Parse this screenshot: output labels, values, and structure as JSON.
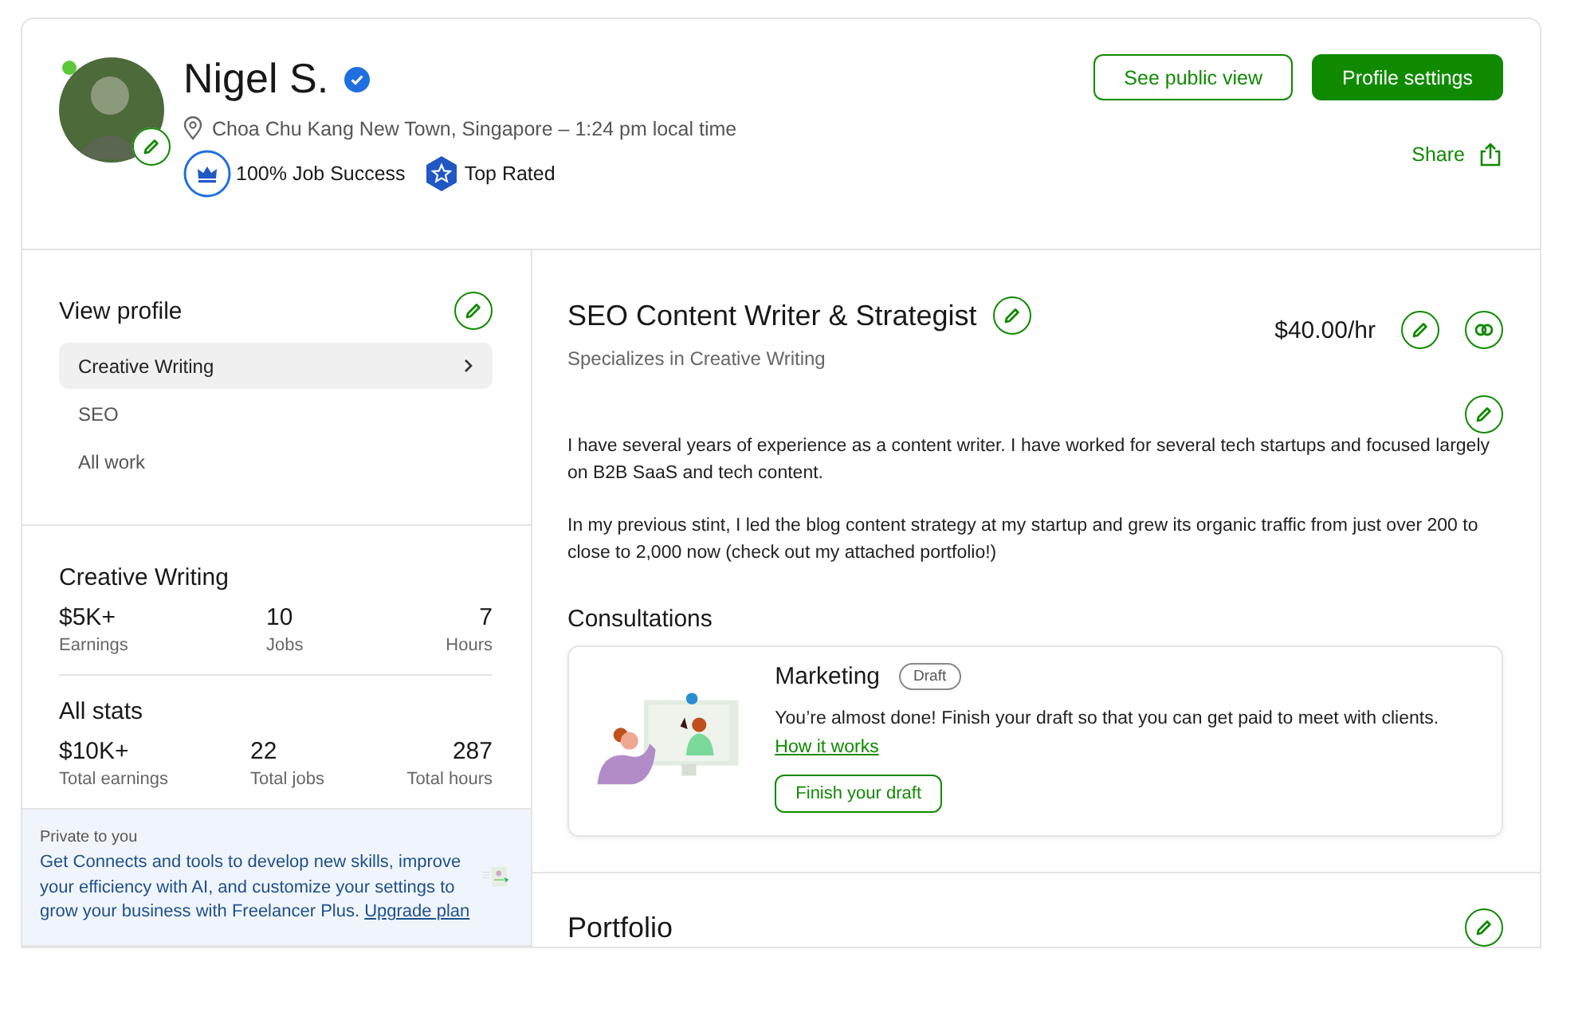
{
  "profile": {
    "name": "Nigel S.",
    "verified": true,
    "online": true,
    "location": "Choa Chu Kang New Town, Singapore – 1:24 pm local time",
    "badges": [
      {
        "kind": "job-success",
        "label": "100% Job Success"
      },
      {
        "kind": "top-rated",
        "label": "Top Rated"
      }
    ]
  },
  "actions": {
    "public_view": "See public view",
    "settings": "Profile settings",
    "share": "Share"
  },
  "sidebar": {
    "title": "View profile",
    "items": [
      {
        "label": "Creative Writing",
        "selected": true
      },
      {
        "label": "SEO",
        "selected": false
      },
      {
        "label": "All work",
        "selected": false
      }
    ]
  },
  "stats_groups": [
    {
      "title": "Creative Writing",
      "stats": [
        {
          "value": "$5K+",
          "label": "Earnings"
        },
        {
          "value": "10",
          "label": "Jobs"
        },
        {
          "value": "7",
          "label": "Hours"
        }
      ]
    },
    {
      "title": "All stats",
      "stats": [
        {
          "value": "$10K+",
          "label": "Total earnings"
        },
        {
          "value": "22",
          "label": "Total jobs"
        },
        {
          "value": "287",
          "label": "Total hours"
        }
      ]
    }
  ],
  "promo": {
    "caption": "Private to you",
    "text": "Get Connects and tools to develop new skills, improve your efficiency with AI, and customize your settings to grow your business with Freelancer Plus.",
    "link": "Upgrade plan"
  },
  "main": {
    "title": "SEO Content Writer & Strategist",
    "subtitle": "Specializes in Creative Writing",
    "rate": "$40.00/hr",
    "overview": [
      "I have several years of experience as a content writer. I have worked for several tech startups and focused largely on B2B SaaS and tech content.",
      "In my previous stint, I led the blog content strategy at my startup and grew its organic traffic from just over 200 to close to 2,000 now (check out my attached portfolio!)"
    ]
  },
  "consultations": {
    "title": "Consultations",
    "card": {
      "name": "Marketing",
      "status": "Draft",
      "text": "You’re almost done! Finish your draft so that you can get paid to meet with clients.",
      "link": "How it works",
      "button": "Finish your draft"
    }
  },
  "portfolio": {
    "title": "Portfolio"
  }
}
